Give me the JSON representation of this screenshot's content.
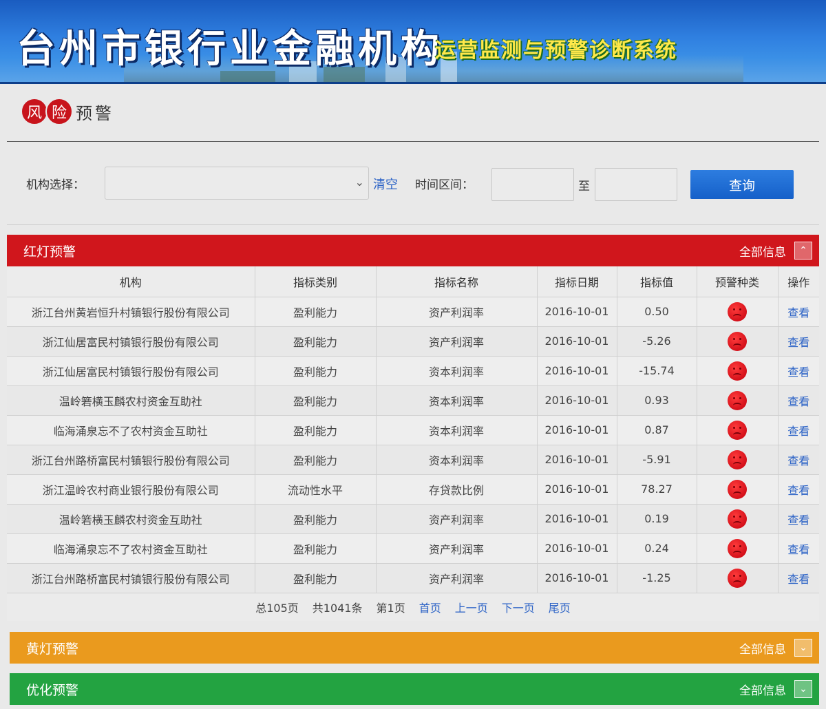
{
  "banner": {
    "title": "台州市银行业金融机构",
    "subtitle": "运营监测与预警诊断系统"
  },
  "section": {
    "circle1": "风",
    "circle2": "险",
    "plain": "预警"
  },
  "filter": {
    "org_label": "机构选择：",
    "org_value": "",
    "clear_label": "清空",
    "time_label": "时间区间：",
    "date_from": "",
    "date_to": "",
    "to_text": "至",
    "query_label": "查询"
  },
  "panels": {
    "red": {
      "title": "红灯预警",
      "all_label": "全部信息",
      "toggle_icon": "chevron-up"
    },
    "yellow": {
      "title": "黄灯预警",
      "all_label": "全部信息",
      "toggle_icon": "chevron-down"
    },
    "green": {
      "title": "优化预警",
      "all_label": "全部信息",
      "toggle_icon": "chevron-down"
    }
  },
  "table": {
    "headers": [
      "机构",
      "指标类别",
      "指标名称",
      "指标日期",
      "指标值",
      "预警种类",
      "操作"
    ],
    "action_label": "查看",
    "warning_icon": "sad-face-icon",
    "rows": [
      [
        "浙江台州黄岩恒升村镇银行股份有限公司",
        "盈利能力",
        "资产利润率",
        "2016-10-01",
        "0.50"
      ],
      [
        "浙江仙居富民村镇银行股份有限公司",
        "盈利能力",
        "资产利润率",
        "2016-10-01",
        "-5.26"
      ],
      [
        "浙江仙居富民村镇银行股份有限公司",
        "盈利能力",
        "资本利润率",
        "2016-10-01",
        "-15.74"
      ],
      [
        "温岭箬横玉麟农村资金互助社",
        "盈利能力",
        "资本利润率",
        "2016-10-01",
        "0.93"
      ],
      [
        "临海涌泉忘不了农村资金互助社",
        "盈利能力",
        "资本利润率",
        "2016-10-01",
        "0.87"
      ],
      [
        "浙江台州路桥富民村镇银行股份有限公司",
        "盈利能力",
        "资本利润率",
        "2016-10-01",
        "-5.91"
      ],
      [
        "浙江温岭农村商业银行股份有限公司",
        "流动性水平",
        "存贷款比例",
        "2016-10-01",
        "78.27"
      ],
      [
        "温岭箬横玉麟农村资金互助社",
        "盈利能力",
        "资产利润率",
        "2016-10-01",
        "0.19"
      ],
      [
        "临海涌泉忘不了农村资金互助社",
        "盈利能力",
        "资产利润率",
        "2016-10-01",
        "0.24"
      ],
      [
        "浙江台州路桥富民村镇银行股份有限公司",
        "盈利能力",
        "资产利润率",
        "2016-10-01",
        "-1.25"
      ]
    ]
  },
  "pager": {
    "total_pages": "总105页",
    "total_records": "共1041条",
    "current_page": "第1页",
    "first": "首页",
    "prev": "上一页",
    "next": "下一页",
    "last": "尾页"
  }
}
